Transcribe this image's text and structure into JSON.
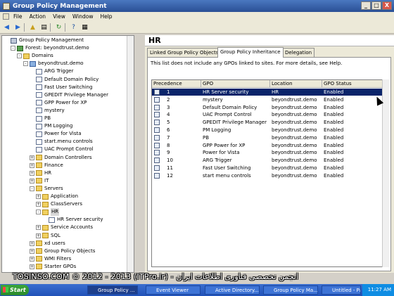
{
  "window": {
    "title": "Group Policy Management",
    "controls": [
      "_",
      "□",
      "X"
    ]
  },
  "menu": [
    "File",
    "Action",
    "View",
    "Window",
    "Help"
  ],
  "toolbar_icons": [
    "back-icon",
    "forward-icon",
    "up-icon",
    "show-tree-icon",
    "refresh-icon",
    "help-icon",
    "properties-icon"
  ],
  "tree": [
    {
      "label": "Group Policy Management",
      "level": 0,
      "exp": "",
      "icon": "gpm"
    },
    {
      "label": "Forest: beyondtrust.demo",
      "level": 1,
      "exp": "-",
      "icon": "forest"
    },
    {
      "label": "Domains",
      "level": 2,
      "exp": "-",
      "icon": "fold"
    },
    {
      "label": "beyondtrust.demo",
      "level": 3,
      "exp": "-",
      "icon": "domain"
    },
    {
      "label": "ARG Trigger",
      "level": 4,
      "exp": "",
      "icon": "gpo"
    },
    {
      "label": "Default Domain Policy",
      "level": 4,
      "exp": "",
      "icon": "gpo"
    },
    {
      "label": "Fast User Switching",
      "level": 4,
      "exp": "",
      "icon": "gpo"
    },
    {
      "label": "GPEDIT Privilege Manager",
      "level": 4,
      "exp": "",
      "icon": "gpo"
    },
    {
      "label": "GPP Power for XP",
      "level": 4,
      "exp": "",
      "icon": "gpo"
    },
    {
      "label": "mystery",
      "level": 4,
      "exp": "",
      "icon": "gpo"
    },
    {
      "label": "PB",
      "level": 4,
      "exp": "",
      "icon": "gpo"
    },
    {
      "label": "PM Logging",
      "level": 4,
      "exp": "",
      "icon": "gpo"
    },
    {
      "label": "Power for Vista",
      "level": 4,
      "exp": "",
      "icon": "gpo"
    },
    {
      "label": "start.menu controls",
      "level": 4,
      "exp": "",
      "icon": "gpo"
    },
    {
      "label": "UAC Prompt Control",
      "level": 4,
      "exp": "",
      "icon": "gpo"
    },
    {
      "label": "Domain Controllers",
      "level": 4,
      "exp": "+",
      "icon": "fold"
    },
    {
      "label": "Finance",
      "level": 4,
      "exp": "+",
      "icon": "fold"
    },
    {
      "label": "HR",
      "level": 4,
      "exp": "+",
      "icon": "fold"
    },
    {
      "label": "IT",
      "level": 4,
      "exp": "+",
      "icon": "fold"
    },
    {
      "label": "Servers",
      "level": 4,
      "exp": "-",
      "icon": "fold"
    },
    {
      "label": "Application",
      "level": 5,
      "exp": "+",
      "icon": "fold"
    },
    {
      "label": "ClassServers",
      "level": 5,
      "exp": "+",
      "icon": "fold"
    },
    {
      "label": "HR",
      "level": 5,
      "exp": "-",
      "icon": "fold",
      "selected": true
    },
    {
      "label": "HR Server security",
      "level": 6,
      "exp": "",
      "icon": "gpo"
    },
    {
      "label": "Service Accounts",
      "level": 5,
      "exp": "+",
      "icon": "fold"
    },
    {
      "label": "SQL",
      "level": 5,
      "exp": "+",
      "icon": "fold"
    },
    {
      "label": "xd users",
      "level": 4,
      "exp": "+",
      "icon": "fold"
    },
    {
      "label": "Group Policy Objects",
      "level": 4,
      "exp": "+",
      "icon": "fold"
    },
    {
      "label": "WMI Filters",
      "level": 4,
      "exp": "+",
      "icon": "fold"
    },
    {
      "label": "Starter GPOs",
      "level": 4,
      "exp": "+",
      "icon": "fold"
    }
  ],
  "right": {
    "header": "HR",
    "tabs": [
      {
        "label": "Linked Group Policy Objects",
        "active": false
      },
      {
        "label": "Group Policy Inheritance",
        "active": true
      },
      {
        "label": "Delegation",
        "active": false
      }
    ],
    "note": "This list does not include any GPOs linked to sites. For more details, see Help.",
    "columns": [
      "Precedence",
      "GPO",
      "Location",
      "GPO Status"
    ],
    "rows": [
      {
        "precedence": "1",
        "gpo": "HR Server security",
        "location": "HR",
        "status": "Enabled"
      },
      {
        "precedence": "2",
        "gpo": "mystery",
        "location": "beyondtrust.demo",
        "status": "Enabled"
      },
      {
        "precedence": "3",
        "gpo": "Default Domain Policy",
        "location": "beyondtrust.demo",
        "status": "Enabled"
      },
      {
        "precedence": "4",
        "gpo": "UAC Prompt Control",
        "location": "beyondtrust.demo",
        "status": "Enabled"
      },
      {
        "precedence": "5",
        "gpo": "GPEDIT Privilege Manager",
        "location": "beyondtrust.demo",
        "status": "Enabled"
      },
      {
        "precedence": "6",
        "gpo": "PM Logging",
        "location": "beyondtrust.demo",
        "status": "Enabled"
      },
      {
        "precedence": "7",
        "gpo": "PB",
        "location": "beyondtrust.demo",
        "status": "Enabled"
      },
      {
        "precedence": "8",
        "gpo": "GPP Power for XP",
        "location": "beyondtrust.demo",
        "status": "Enabled"
      },
      {
        "precedence": "9",
        "gpo": "Power for Vista",
        "location": "beyondtrust.demo",
        "status": "Enabled"
      },
      {
        "precedence": "10",
        "gpo": "ARG Trigger",
        "location": "beyondtrust.demo",
        "status": "Enabled"
      },
      {
        "precedence": "11",
        "gpo": "Fast User Switching",
        "location": "beyondtrust.demo",
        "status": "Enabled"
      },
      {
        "precedence": "12",
        "gpo": "start menu controls",
        "location": "beyondtrust.demo",
        "status": "Enabled"
      }
    ]
  },
  "taskbar": {
    "start": "Start",
    "buttons": [
      {
        "label": "Group Policy ...",
        "active": true
      },
      {
        "label": "Event Viewer",
        "active": false
      },
      {
        "label": "Active Directory...",
        "active": false
      },
      {
        "label": "Group Policy Ma...",
        "active": false
      },
      {
        "label": "Untitled - Paint",
        "active": false
      }
    ],
    "clock": "11:27 AM"
  },
  "watermark": "TOSINSO.COM © 2012 - 2013 (ITPro.ir) - انجمن تخصصی فناوری اطلاعات ایران"
}
